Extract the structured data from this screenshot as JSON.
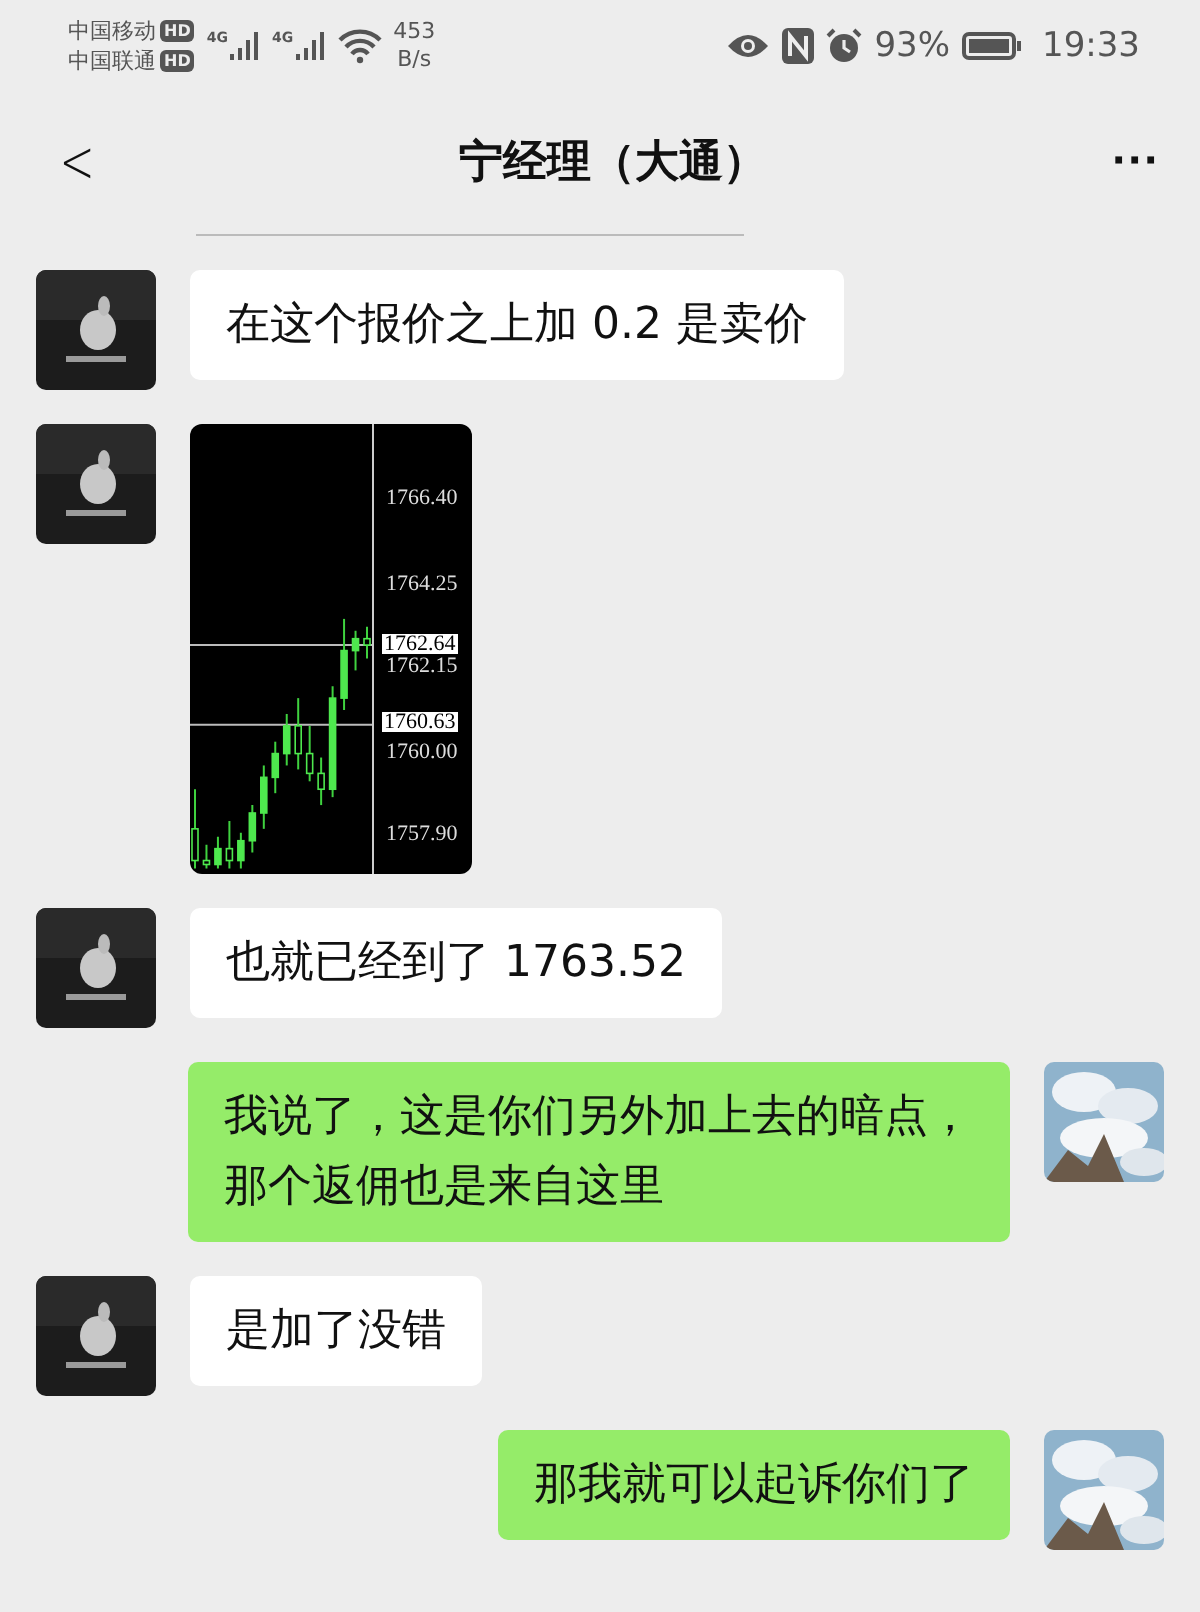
{
  "status_bar": {
    "carriers": [
      {
        "name": "中国移动",
        "badge": "HD"
      },
      {
        "name": "中国联通",
        "badge": "HD"
      }
    ],
    "networks": [
      "4G",
      "4G"
    ],
    "speed": "453",
    "speed_unit": "B/s",
    "battery_text": "93%",
    "time": "19:33"
  },
  "header": {
    "back": "<",
    "title": "宁经理（大通）",
    "more": "···"
  },
  "messages": [
    {
      "kind": "text",
      "outgoing": false,
      "text": "在这个报价之上加 0.2 是卖价"
    },
    {
      "outgoing": false,
      "chart_data": {
        "type": "candlestick",
        "ohlc": [
          [
            1758.0,
            1759.0,
            1757.0,
            1757.2
          ],
          [
            1757.2,
            1757.6,
            1757.0,
            1757.1
          ],
          [
            1757.1,
            1757.8,
            1757.0,
            1757.5
          ],
          [
            1757.5,
            1758.2,
            1757.0,
            1757.2
          ],
          [
            1757.2,
            1757.9,
            1757.0,
            1757.7
          ],
          [
            1757.7,
            1758.6,
            1757.4,
            1758.4
          ],
          [
            1758.4,
            1759.6,
            1758.0,
            1759.3
          ],
          [
            1759.3,
            1760.2,
            1758.9,
            1759.9
          ],
          [
            1759.9,
            1760.9,
            1759.6,
            1760.6
          ],
          [
            1760.6,
            1761.3,
            1759.5,
            1759.9
          ],
          [
            1759.9,
            1760.6,
            1759.2,
            1759.4
          ],
          [
            1759.4,
            1759.8,
            1758.6,
            1759.0
          ],
          [
            1759.0,
            1761.6,
            1758.8,
            1761.3
          ],
          [
            1761.3,
            1763.3,
            1761.0,
            1762.5
          ],
          [
            1762.5,
            1763.0,
            1762.0,
            1762.8
          ],
          [
            1762.8,
            1763.1,
            1762.3,
            1762.64
          ]
        ],
        "ylim": [
          1756.86,
          1768.22
        ],
        "yticks": [
          {
            "value": 1766.4,
            "label": "1766.40"
          },
          {
            "value": 1764.25,
            "label": "1764.25"
          },
          {
            "value": 1762.15,
            "label": "1762.15"
          },
          {
            "value": 1760.0,
            "label": "1760.00"
          },
          {
            "value": 1757.9,
            "label": "1757.90"
          }
        ],
        "ref_lines": [
          {
            "axis": "y",
            "value": 1762.64,
            "label": "1762.64"
          },
          {
            "axis": "y",
            "value": 1760.63,
            "label": "1760.63"
          }
        ]
      }
    },
    {
      "kind": "text",
      "outgoing": false,
      "text": "也就已经到了 1763.52"
    },
    {
      "kind": "text",
      "outgoing": true,
      "text": "我说了，这是你们另外加上去的暗点，那个返佣也是来自这里"
    },
    {
      "kind": "text",
      "outgoing": false,
      "text": "是加了没错"
    },
    {
      "kind": "text",
      "outgoing": true,
      "text": "那我就可以起诉你们了"
    }
  ]
}
